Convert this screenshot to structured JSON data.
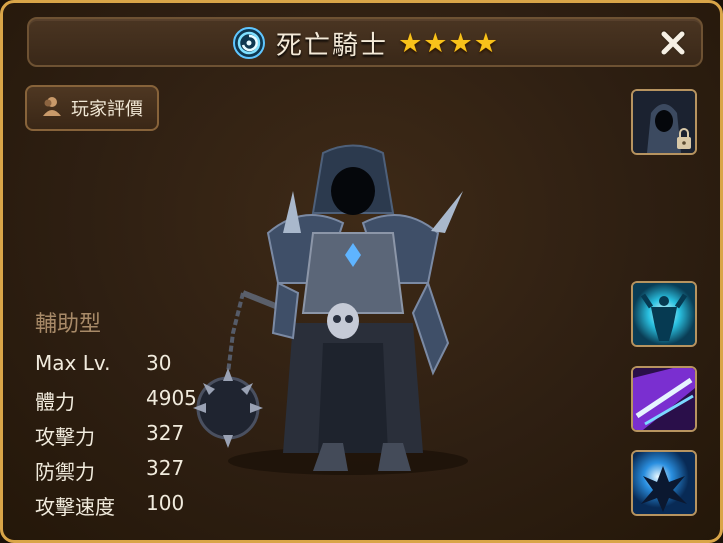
{
  "window": {
    "title": "死亡騎士",
    "stars": 4,
    "element_icon": "wind-swirl-icon",
    "close_icon": "close-x-icon"
  },
  "review_button": {
    "label": "玩家評價",
    "icon": "person-icon"
  },
  "side_slots": {
    "top": {
      "icon": "hooded-knight-portrait-locked-icon"
    },
    "skills": [
      {
        "icon": "aura-power-skill-icon"
      },
      {
        "icon": "purple-slash-skill-icon"
      },
      {
        "icon": "blue-impact-skill-icon"
      }
    ]
  },
  "monster": {
    "type": "輔助型",
    "stats": [
      {
        "name": "Max Lv.",
        "value": "30"
      },
      {
        "name": "體力",
        "value": "4905"
      },
      {
        "name": "攻擊力",
        "value": "327"
      },
      {
        "name": "防禦力",
        "value": "327"
      },
      {
        "name": "攻擊速度",
        "value": "100"
      }
    ]
  },
  "colors": {
    "gold_border": "#d9a548",
    "panel_bg": "#2e1f12",
    "star": "#f8c21a",
    "type_text": "#a88a68"
  }
}
